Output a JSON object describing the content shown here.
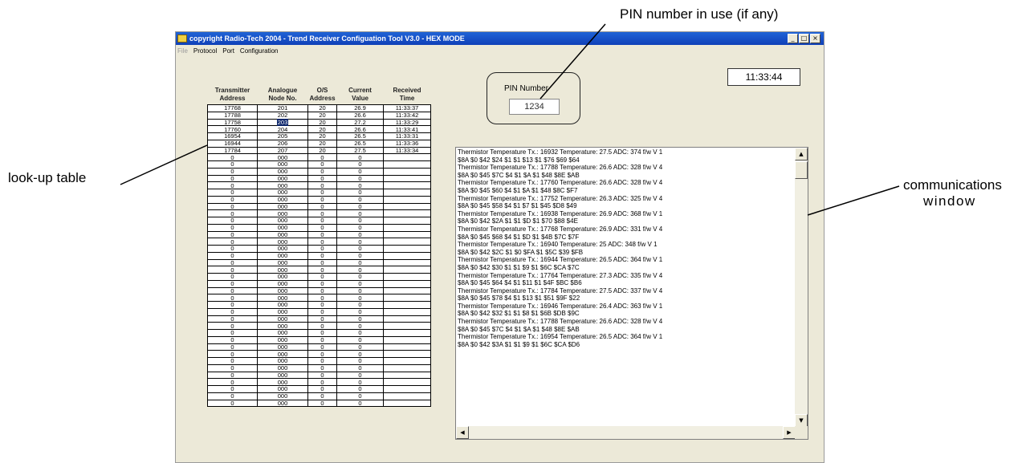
{
  "callouts": {
    "pin": "PIN number in use (if any)",
    "lookup": "look-up table",
    "comms_line1": "communications",
    "comms_line2": "window"
  },
  "window": {
    "title": "copyright Radio-Tech 2004 - Trend Receiver Configuation Tool V3.0 - HEX MODE",
    "buttons": {
      "minimize": "_",
      "maximize": "□",
      "close": "×"
    }
  },
  "menu": {
    "file": "File",
    "protocol": "Protocol",
    "port": "Port",
    "configuration": "Configuration"
  },
  "table": {
    "headers": {
      "c1a": "Transmitter",
      "c1b": "Address",
      "c2a": "Analogue",
      "c2b": "Node No.",
      "c3a": "O/S",
      "c3b": "Address",
      "c4a": "Current",
      "c4b": "Value",
      "c5a": "Received",
      "c5b": "Time"
    },
    "rows": [
      [
        "17768",
        "201",
        "20",
        "26.9",
        "11:33:37"
      ],
      [
        "17788",
        "202",
        "20",
        "26.6",
        "11:33:42"
      ],
      [
        "17758",
        "203",
        "20",
        "27.2",
        "11:33:29"
      ],
      [
        "17760",
        "204",
        "20",
        "26.6",
        "11:33:41"
      ],
      [
        "16954",
        "205",
        "20",
        "26.5",
        "11:33:31"
      ],
      [
        "16944",
        "206",
        "20",
        "26.5",
        "11:33:36"
      ],
      [
        "17784",
        "207",
        "20",
        "27.5",
        "11:33:34"
      ],
      [
        "0",
        "000",
        "0",
        "0",
        ""
      ],
      [
        "0",
        "000",
        "0",
        "0",
        ""
      ],
      [
        "0",
        "000",
        "0",
        "0",
        ""
      ],
      [
        "0",
        "000",
        "0",
        "0",
        ""
      ],
      [
        "0",
        "000",
        "0",
        "0",
        ""
      ],
      [
        "0",
        "000",
        "0",
        "0",
        ""
      ],
      [
        "0",
        "000",
        "0",
        "0",
        ""
      ],
      [
        "0",
        "000",
        "0",
        "0",
        ""
      ],
      [
        "0",
        "000",
        "0",
        "0",
        ""
      ],
      [
        "0",
        "000",
        "0",
        "0",
        ""
      ],
      [
        "0",
        "000",
        "0",
        "0",
        ""
      ],
      [
        "0",
        "000",
        "0",
        "0",
        ""
      ],
      [
        "0",
        "000",
        "0",
        "0",
        ""
      ],
      [
        "0",
        "000",
        "0",
        "0",
        ""
      ],
      [
        "0",
        "000",
        "0",
        "0",
        ""
      ],
      [
        "0",
        "000",
        "0",
        "0",
        ""
      ],
      [
        "0",
        "000",
        "0",
        "0",
        ""
      ],
      [
        "0",
        "000",
        "0",
        "0",
        ""
      ],
      [
        "0",
        "000",
        "0",
        "0",
        ""
      ],
      [
        "0",
        "000",
        "0",
        "0",
        ""
      ],
      [
        "0",
        "000",
        "0",
        "0",
        ""
      ],
      [
        "0",
        "000",
        "0",
        "0",
        ""
      ],
      [
        "0",
        "000",
        "0",
        "0",
        ""
      ],
      [
        "0",
        "000",
        "0",
        "0",
        ""
      ],
      [
        "0",
        "000",
        "0",
        "0",
        ""
      ],
      [
        "0",
        "000",
        "0",
        "0",
        ""
      ],
      [
        "0",
        "000",
        "0",
        "0",
        ""
      ],
      [
        "0",
        "000",
        "0",
        "0",
        ""
      ],
      [
        "0",
        "000",
        "0",
        "0",
        ""
      ],
      [
        "0",
        "000",
        "0",
        "0",
        ""
      ],
      [
        "0",
        "000",
        "0",
        "0",
        ""
      ],
      [
        "0",
        "000",
        "0",
        "0",
        ""
      ],
      [
        "0",
        "000",
        "0",
        "0",
        ""
      ],
      [
        "0",
        "000",
        "0",
        "0",
        ""
      ],
      [
        "0",
        "000",
        "0",
        "0",
        ""
      ],
      [
        "0",
        "000",
        "0",
        "0",
        ""
      ]
    ],
    "selected_cell": {
      "row": 2,
      "col": 1
    }
  },
  "pin": {
    "label": "PIN Number",
    "value": "1234"
  },
  "clock": "11:33:44",
  "comms": {
    "lines": [
      "Thermistor Temperature Tx.: 16932   Temperature: 27.5   ADC: 374  f/w V 1",
      "$8A $0 $42 $24 $1 $1 $13 $1 $76 $69 $64",
      "Thermistor Temperature Tx.: 17788   Temperature: 26.6   ADC: 328  f/w V 4",
      "$8A $0 $45 $7C $4 $1 $A $1 $48 $8E $AB",
      "Thermistor Temperature Tx.: 17760   Temperature: 26.6   ADC: 328  f/w V 4",
      "$8A $0 $45 $60 $4 $1 $A $1 $48 $8C $F7",
      "Thermistor Temperature Tx.: 17752   Temperature: 26.3   ADC: 325  f/w V 4",
      "$8A $0 $45 $58 $4 $1 $7 $1 $45 $D8 $49",
      "Thermistor Temperature Tx.: 16938   Temperature: 26.9   ADC: 368  f/w V 1",
      "$8A $0 $42 $2A $1 $1 $D $1 $70 $88 $4E",
      "Thermistor Temperature Tx.: 17768   Temperature: 26.9   ADC: 331  f/w V 4",
      "$8A $0 $45 $68 $4 $1 $D $1 $4B $7C $7F",
      "Thermistor Temperature Tx.: 16940   Temperature: 25   ADC: 348  f/w V 1",
      "$8A $0 $42 $2C $1 $0 $FA $1 $5C $39 $FB",
      "Thermistor Temperature Tx.: 16944   Temperature: 26.5   ADC: 364  f/w V 1",
      "$8A $0 $42 $30 $1 $1 $9 $1 $6C $CA $7C",
      "Thermistor Temperature Tx.: 17764   Temperature: 27.3   ADC: 335  f/w V 4",
      "$8A $0 $45 $64 $4 $1 $11 $1 $4F $BC $B6",
      "Thermistor Temperature Tx.: 17784   Temperature: 27.5   ADC: 337  f/w V 4",
      "$8A $0 $45 $78 $4 $1 $13 $1 $51 $9F $22",
      "Thermistor Temperature Tx.: 16946   Temperature: 26.4   ADC: 363  f/w V 1",
      "$8A $0 $42 $32 $1 $1 $8 $1 $6B $DB $9C",
      "Thermistor Temperature Tx.: 17788   Temperature: 26.6   ADC: 328  f/w V 4",
      "$8A $0 $45 $7C $4 $1 $A $1 $48 $8E $AB",
      "Thermistor Temperature Tx.: 16954   Temperature: 26.5   ADC: 364  f/w V 1",
      "$8A $0 $42 $3A $1 $1 $9 $1 $6C $CA $D6"
    ],
    "scroll": {
      "up": "▲",
      "down": "▼",
      "left": "◀",
      "right": "▶"
    }
  }
}
